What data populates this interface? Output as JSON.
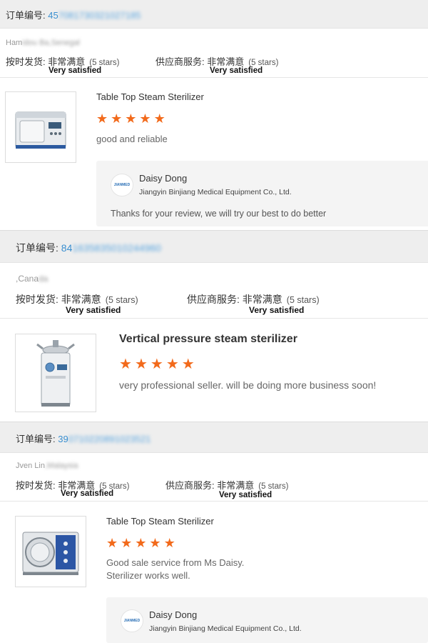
{
  "orders": [
    {
      "order_label": "订单编号:",
      "order_prefix": "45",
      "order_masked": "7081730321027185",
      "buyer_name": "Ham",
      "buyer_masked": "idou Ba,Senegal",
      "shipping_label": "按时发货:",
      "shipping_value": "非常满意",
      "shipping_stars": "(5 stars)",
      "shipping_satisfied": "Very satisfied",
      "service_label": "供应商服务:",
      "service_value": "非常满意",
      "service_stars": "(5 stars)",
      "service_satisfied": "Very satisfied",
      "product_title": "Table Top Steam Sterilizer",
      "rating": 5,
      "comment": "good and reliable",
      "reply": {
        "name": "Daisy Dong",
        "company": "Jiangyin Binjiang Medical Equipment Co., Ltd.",
        "text": "Thanks for your review, we will try our best to do better",
        "logo_text": "JIANMED"
      }
    },
    {
      "order_label": "订单编号:",
      "order_prefix": "84",
      "order_masked": "1635835010244960",
      "buyer_name": ",Cana",
      "buyer_masked": "da",
      "shipping_label": "按时发货:",
      "shipping_value": "非常满意",
      "shipping_stars": "(5 stars)",
      "shipping_satisfied": "Very satisfied",
      "service_label": "供应商服务:",
      "service_value": "非常满意",
      "service_stars": "(5 stars)",
      "service_satisfied": "Very satisfied",
      "product_title": "Vertical pressure steam sterilizer",
      "rating": 5,
      "comment": "very professional seller. will be doing more business soon!"
    },
    {
      "order_label": "订单编号:",
      "order_prefix": "39",
      "order_masked": "0710220891023521",
      "buyer_name": "Jven Lin",
      "buyer_masked": ",Malaysia",
      "shipping_label": "按时发货:",
      "shipping_value": "非常满意",
      "shipping_stars": "(5 stars)",
      "shipping_satisfied": "Very satisfied",
      "service_label": "供应商服务:",
      "service_value": "非常满意",
      "service_stars": "(5 stars)",
      "service_satisfied": "Very satisfied",
      "product_title": "Table Top Steam Sterilizer",
      "rating": 5,
      "comment_line1": "Good sale service from Ms Daisy.",
      "comment_line2": "Sterilizer works well.",
      "reply": {
        "name": "Daisy Dong",
        "company": "Jiangyin Binjiang Medical Equipment Co., Ltd.",
        "logo_text": "JIANMED"
      }
    }
  ],
  "colors": {
    "star": "#f26a1b",
    "order_number": "#3a8fd0",
    "header_bg": "#eeeeee",
    "reply_bg": "#f4f4f4"
  },
  "icons": {
    "star": "star-icon",
    "autoclave_thumb": "autoclave-product-image",
    "vertical_sterilizer_thumb": "vertical-sterilizer-product-image",
    "table_sterilizer_thumb": "table-sterilizer-product-image",
    "company_logo": "company-logo-icon"
  }
}
